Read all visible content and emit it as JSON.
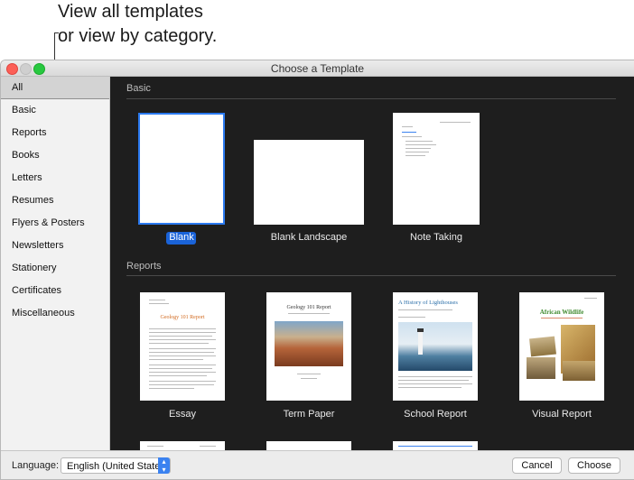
{
  "callout": {
    "line1": "View all templates",
    "line2": "or view by category."
  },
  "window": {
    "title": "Choose a Template"
  },
  "sidebar": {
    "items": [
      {
        "label": "All"
      },
      {
        "label": "Basic"
      },
      {
        "label": "Reports"
      },
      {
        "label": "Books"
      },
      {
        "label": "Letters"
      },
      {
        "label": "Resumes"
      },
      {
        "label": "Flyers & Posters"
      },
      {
        "label": "Newsletters"
      },
      {
        "label": "Stationery"
      },
      {
        "label": "Certificates"
      },
      {
        "label": "Miscellaneous"
      }
    ]
  },
  "sections": {
    "basic": {
      "title": "Basic",
      "templates": [
        {
          "label": "Blank"
        },
        {
          "label": "Blank Landscape"
        },
        {
          "label": "Note Taking"
        }
      ]
    },
    "reports": {
      "title": "Reports",
      "templates": [
        {
          "label": "Essay",
          "doc_title": "Geology 101 Report"
        },
        {
          "label": "Term Paper",
          "doc_title": "Geology 101 Report"
        },
        {
          "label": "School Report",
          "doc_title": "A History of Lighthouses"
        },
        {
          "label": "Visual Report",
          "doc_title": "African Wildlife"
        }
      ]
    }
  },
  "bottom": {
    "language_label": "Language:",
    "language_value": "English (United States)",
    "cancel": "Cancel",
    "choose": "Choose"
  },
  "colors": {
    "accent": "#2b7af0",
    "gallery_bg": "#1e1e1e"
  }
}
